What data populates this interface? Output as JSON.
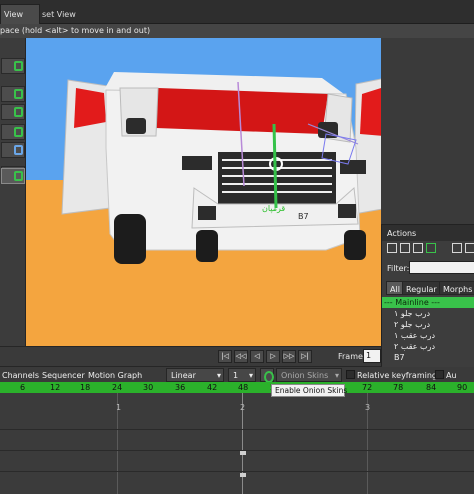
{
  "topbar": {
    "left_tab": "View",
    "asset_tab": "set View"
  },
  "hint": "pace (hold <alt> to move in and out)",
  "viewport": {
    "ground_labels": [
      "B7",
      "قرمپان"
    ]
  },
  "playback": {
    "buttons": [
      "|◁",
      "◁◁",
      "◁",
      "▷",
      "▷▷",
      "▷|"
    ],
    "frame_label": "Frame",
    "frame_value": "1"
  },
  "timeline": {
    "tabs": [
      "Channels",
      "Sequencer",
      "Motion Graph"
    ],
    "interp": "Linear",
    "step": "1",
    "onion": "Onion Skins",
    "relative_keyframing": "Relative keyframing",
    "auto": "Au",
    "ruler": [
      "6",
      "12",
      "18",
      "24",
      "30",
      "36",
      "42",
      "48",
      "54",
      "60",
      "66",
      "72",
      "78",
      "84",
      "90"
    ],
    "key_numbers": [
      "1",
      "2",
      "3"
    ],
    "tooltip": "Enable Onion Skins"
  },
  "actions": {
    "title": "Actions",
    "filter_label": "Filter:",
    "tabs": [
      "All",
      "Regular",
      "Morphs"
    ],
    "items": [
      "--- Mainline ---",
      "درب جلو ۱",
      "درب جلو ۲",
      "درب عقب ۱",
      "درب عقب ۲",
      "B7"
    ]
  },
  "colors": {
    "accent": "#39c24a",
    "sky": "#5aa3ef",
    "ground": "#f4a53f",
    "car_body": "#f2f2f2",
    "window": "#e21b1b"
  }
}
